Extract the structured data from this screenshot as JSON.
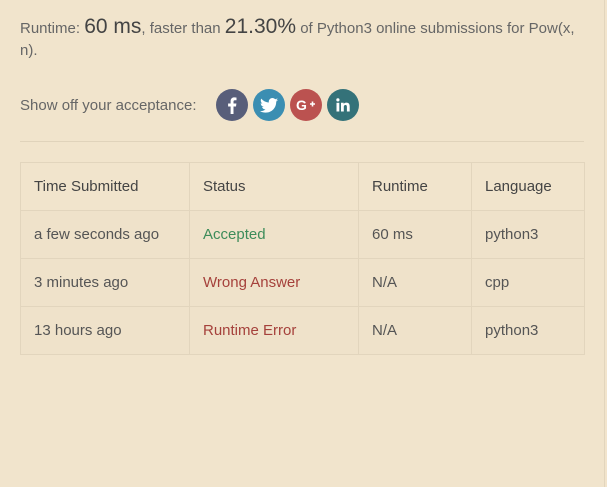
{
  "summary": {
    "runtime_label": "Runtime:",
    "runtime_value": "60 ms",
    "faster_text": ", faster than",
    "percent": "21.30%",
    "tail_text": "of Python3 online submissions for Pow(x, n)."
  },
  "share": {
    "label": "Show off your acceptance:",
    "buttons": [
      {
        "name": "facebook",
        "icon": "facebook-icon",
        "color": "#585e7a"
      },
      {
        "name": "twitter",
        "icon": "twitter-icon",
        "color": "#3b8eb2"
      },
      {
        "name": "google-plus",
        "icon": "google-plus-icon",
        "color": "#bb5250"
      },
      {
        "name": "linkedin",
        "icon": "linkedin-icon",
        "color": "#347279"
      }
    ]
  },
  "table": {
    "headers": [
      "Time Submitted",
      "Status",
      "Runtime",
      "Language"
    ],
    "rows": [
      {
        "time": "a few seconds ago",
        "status": "Accepted",
        "runtime": "60 ms",
        "language": "python3"
      },
      {
        "time": "3 minutes ago",
        "status": "Wrong Answer",
        "runtime": "N/A",
        "language": "cpp"
      },
      {
        "time": "13 hours ago",
        "status": "Runtime Error",
        "runtime": "N/A",
        "language": "python3"
      }
    ]
  },
  "colors": {
    "accepted": "#3d8c5a",
    "wrong_answer": "#a5413b",
    "runtime_error": "#a5413b",
    "background": "#f1e4cc"
  }
}
